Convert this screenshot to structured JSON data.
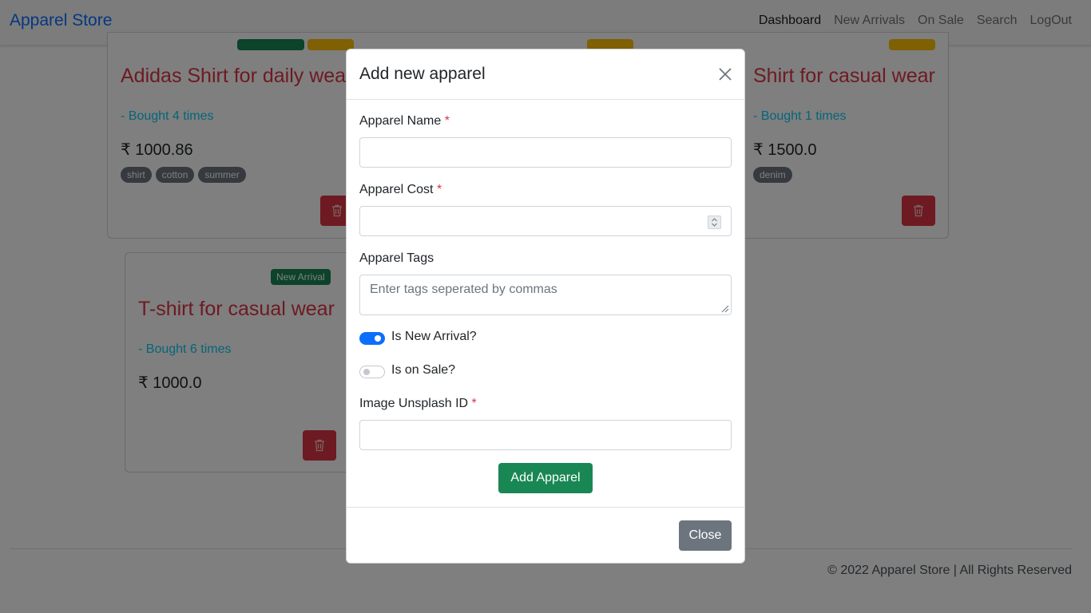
{
  "navbar": {
    "brand": "Apparel Store",
    "links": [
      "Dashboard",
      "New Arrivals",
      "On Sale",
      "Search",
      "LogOut"
    ]
  },
  "cards": [
    {
      "title": "Adidas Shirt for daily wear",
      "bought": "- Bought 4 times",
      "price": "₹ 1000.86",
      "tags": [
        "shirt",
        "cotton",
        "summer"
      ]
    },
    {
      "title": "Shirt for casual wear",
      "bought": "- Bought 1 times",
      "price": "₹ 1500.0",
      "tags": [
        "denim"
      ]
    },
    {
      "badge": "New Arrival",
      "title": "T-shirt for casual wear",
      "bought": "- Bought 6 times",
      "price": "₹ 1000.0",
      "tags": []
    }
  ],
  "footer": {
    "text": "© 2022 Apparel Store | All Rights Reserved"
  },
  "modal": {
    "title": "Add new apparel",
    "name_label": "Apparel Name",
    "name_value": "",
    "cost_label": "Apparel Cost",
    "cost_value": "",
    "tags_label": "Apparel Tags",
    "tags_placeholder": "Enter tags seperated by commas",
    "new_arrival_label": "Is New Arrival?",
    "new_arrival_checked": true,
    "on_sale_label": "Is on Sale?",
    "on_sale_checked": false,
    "image_label": "Image Unsplash ID",
    "image_value": "",
    "required_mark": "*",
    "submit_label": "Add Apparel",
    "close_label": "Close"
  },
  "colors": {
    "brand": "#0d6efd",
    "danger": "#dc3545",
    "success": "#198754",
    "info": "#0dcaf0",
    "secondary": "#6c757d",
    "warning": "#ffc107"
  }
}
